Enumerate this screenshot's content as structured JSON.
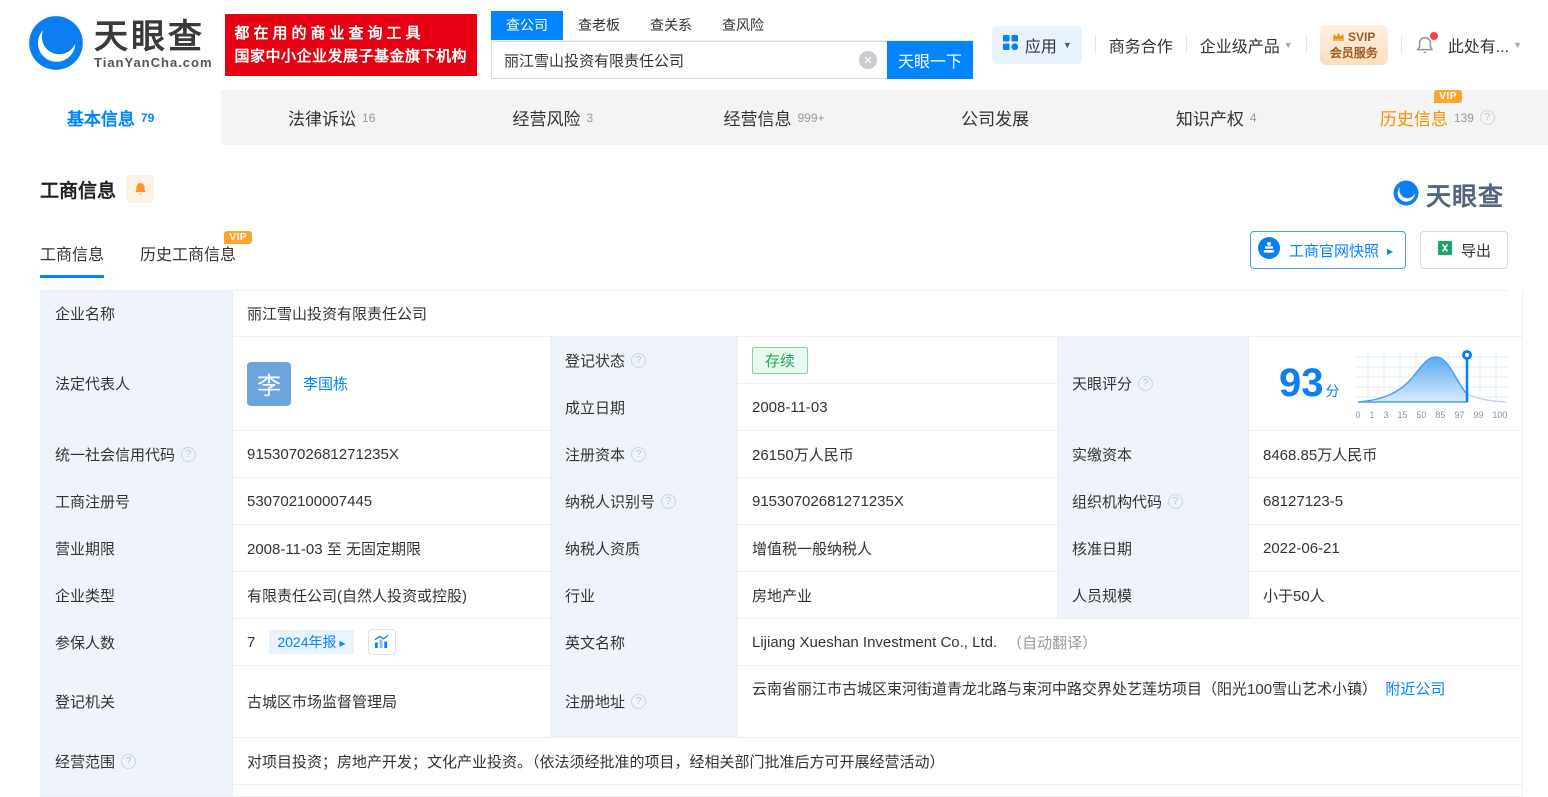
{
  "colors": {
    "accent": "#0084ff",
    "banner_red": "#e60012",
    "vip_orange": "#ffa42d",
    "status_green": "#23a757",
    "label_bg": "#eef4fa"
  },
  "header": {
    "logo": {
      "name": "天眼查",
      "domain": "TianYanCha.com"
    },
    "banner": {
      "line1": "都在用的商业查询工具",
      "line2": "国家中小企业发展子基金旗下机构"
    },
    "search": {
      "tabs": [
        {
          "label": "查公司"
        },
        {
          "label": "查老板"
        },
        {
          "label": "查关系"
        },
        {
          "label": "查风险"
        }
      ],
      "value": "丽江雪山投资有限责任公司",
      "button": "天眼一下"
    },
    "nav": {
      "apps": "应用",
      "cooperation": "商务合作",
      "enterprise": "企业级产品",
      "svip_line1": "SVIP",
      "svip_line2": "会员服务",
      "user": "此处有..."
    }
  },
  "tabs": [
    {
      "label": "基本信息",
      "count": "79"
    },
    {
      "label": "法律诉讼",
      "count": "16"
    },
    {
      "label": "经营风险",
      "count": "3"
    },
    {
      "label": "经营信息",
      "count": "999+"
    },
    {
      "label": "公司发展",
      "count": ""
    },
    {
      "label": "知识产权",
      "count": "4"
    },
    {
      "label": "历史信息",
      "count": "139",
      "vip": "VIP"
    }
  ],
  "section": {
    "title": "工商信息",
    "watermark": "天眼查",
    "subtabs": [
      {
        "label": "工商信息"
      },
      {
        "label": "历史工商信息",
        "vip": "VIP"
      }
    ],
    "snapshot_button": "工商官网快照",
    "export_button": "导出"
  },
  "fields": {
    "company_name": {
      "label": "企业名称",
      "value": "丽江雪山投资有限责任公司"
    },
    "legal_rep": {
      "label": "法定代表人",
      "value": "李国栋",
      "avatar": "李"
    },
    "reg_status": {
      "label": "登记状态",
      "value": "存续"
    },
    "establish_date": {
      "label": "成立日期",
      "value": "2008-11-03"
    },
    "tyc_score": {
      "label": "天眼评分"
    },
    "credit_code": {
      "label": "统一社会信用代码",
      "value": "91530702681271235X"
    },
    "reg_capital": {
      "label": "注册资本",
      "value": "26150万人民币"
    },
    "paid_capital": {
      "label": "实缴资本",
      "value": "8468.85万人民币"
    },
    "reg_number": {
      "label": "工商注册号",
      "value": "530702100007445"
    },
    "taxpayer_id": {
      "label": "纳税人识别号",
      "value": "91530702681271235X"
    },
    "org_code": {
      "label": "组织机构代码",
      "value": "68127123-5"
    },
    "business_term": {
      "label": "营业期限",
      "value": "2008-11-03 至 无固定期限"
    },
    "taxpayer_quality": {
      "label": "纳税人资质",
      "value": "增值税一般纳税人"
    },
    "approval_date": {
      "label": "核准日期",
      "value": "2022-06-21"
    },
    "company_type": {
      "label": "企业类型",
      "value": "有限责任公司(自然人投资或控股)"
    },
    "industry": {
      "label": "行业",
      "value": "房地产业"
    },
    "staff_size": {
      "label": "人员规模",
      "value": "小于50人"
    },
    "insured_count": {
      "label": "参保人数",
      "value": "7",
      "badge": "2024年报"
    },
    "english_name": {
      "label": "英文名称",
      "value": "Lijiang Xueshan Investment Co., Ltd.",
      "note": "（自动翻译）"
    },
    "reg_authority": {
      "label": "登记机关",
      "value": "古城区市场监督管理局"
    },
    "reg_address": {
      "label": "注册地址",
      "value": "云南省丽江市古城区束河街道青龙北路与束河中路交界处艺莲坊项目（阳光100雪山艺术小镇）",
      "link": "附近公司"
    },
    "business_scope": {
      "label": "经营范围",
      "value": "对项目投资；房地产开发；文化产业投资。（依法须经批准的项目，经相关部门批准后方可开展经营活动）"
    }
  },
  "score_chart": {
    "value": "93",
    "unit": "分",
    "axis": [
      "0",
      "1",
      "3",
      "15",
      "50",
      "85",
      "97",
      "99",
      "100"
    ]
  }
}
